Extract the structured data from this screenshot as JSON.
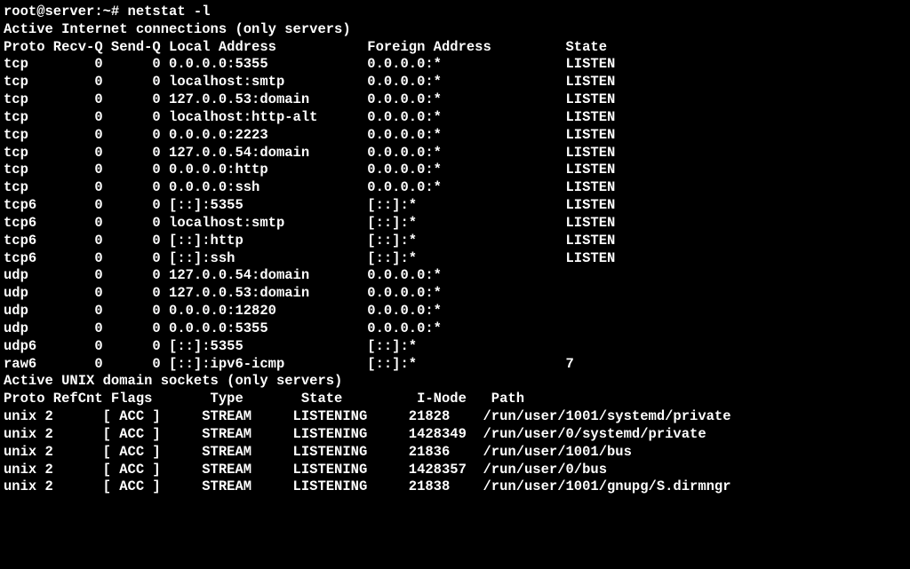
{
  "prompt_line": "root@server:~# netstat -l",
  "inet_header": "Active Internet connections (only servers)",
  "inet_cols": "Proto Recv-Q Send-Q Local Address           Foreign Address         State",
  "inet_rows": [
    {
      "proto": "tcp",
      "recvq": 0,
      "sendq": 0,
      "local": "0.0.0.0:5355",
      "foreign": "0.0.0.0:*",
      "state": "LISTEN"
    },
    {
      "proto": "tcp",
      "recvq": 0,
      "sendq": 0,
      "local": "localhost:smtp",
      "foreign": "0.0.0.0:*",
      "state": "LISTEN"
    },
    {
      "proto": "tcp",
      "recvq": 0,
      "sendq": 0,
      "local": "127.0.0.53:domain",
      "foreign": "0.0.0.0:*",
      "state": "LISTEN"
    },
    {
      "proto": "tcp",
      "recvq": 0,
      "sendq": 0,
      "local": "localhost:http-alt",
      "foreign": "0.0.0.0:*",
      "state": "LISTEN"
    },
    {
      "proto": "tcp",
      "recvq": 0,
      "sendq": 0,
      "local": "0.0.0.0:2223",
      "foreign": "0.0.0.0:*",
      "state": "LISTEN"
    },
    {
      "proto": "tcp",
      "recvq": 0,
      "sendq": 0,
      "local": "127.0.0.54:domain",
      "foreign": "0.0.0.0:*",
      "state": "LISTEN"
    },
    {
      "proto": "tcp",
      "recvq": 0,
      "sendq": 0,
      "local": "0.0.0.0:http",
      "foreign": "0.0.0.0:*",
      "state": "LISTEN"
    },
    {
      "proto": "tcp",
      "recvq": 0,
      "sendq": 0,
      "local": "0.0.0.0:ssh",
      "foreign": "0.0.0.0:*",
      "state": "LISTEN"
    },
    {
      "proto": "tcp6",
      "recvq": 0,
      "sendq": 0,
      "local": "[::]:5355",
      "foreign": "[::]:*",
      "state": "LISTEN"
    },
    {
      "proto": "tcp6",
      "recvq": 0,
      "sendq": 0,
      "local": "localhost:smtp",
      "foreign": "[::]:*",
      "state": "LISTEN"
    },
    {
      "proto": "tcp6",
      "recvq": 0,
      "sendq": 0,
      "local": "[::]:http",
      "foreign": "[::]:*",
      "state": "LISTEN"
    },
    {
      "proto": "tcp6",
      "recvq": 0,
      "sendq": 0,
      "local": "[::]:ssh",
      "foreign": "[::]:*",
      "state": "LISTEN"
    },
    {
      "proto": "udp",
      "recvq": 0,
      "sendq": 0,
      "local": "127.0.0.54:domain",
      "foreign": "0.0.0.0:*",
      "state": ""
    },
    {
      "proto": "udp",
      "recvq": 0,
      "sendq": 0,
      "local": "127.0.0.53:domain",
      "foreign": "0.0.0.0:*",
      "state": ""
    },
    {
      "proto": "udp",
      "recvq": 0,
      "sendq": 0,
      "local": "0.0.0.0:12820",
      "foreign": "0.0.0.0:*",
      "state": ""
    },
    {
      "proto": "udp",
      "recvq": 0,
      "sendq": 0,
      "local": "0.0.0.0:5355",
      "foreign": "0.0.0.0:*",
      "state": ""
    },
    {
      "proto": "udp6",
      "recvq": 0,
      "sendq": 0,
      "local": "[::]:5355",
      "foreign": "[::]:*",
      "state": ""
    },
    {
      "proto": "raw6",
      "recvq": 0,
      "sendq": 0,
      "local": "[::]:ipv6-icmp",
      "foreign": "[::]:*",
      "state": "7"
    }
  ],
  "unix_header": "Active UNIX domain sockets (only servers)",
  "unix_cols": "Proto RefCnt Flags       Type       State         I-Node   Path",
  "unix_rows": [
    {
      "proto": "unix",
      "refcnt": 2,
      "flags": "[ ACC ]",
      "type": "STREAM",
      "state": "LISTENING",
      "inode": 21828,
      "path": "/run/user/1001/systemd/private"
    },
    {
      "proto": "unix",
      "refcnt": 2,
      "flags": "[ ACC ]",
      "type": "STREAM",
      "state": "LISTENING",
      "inode": 1428349,
      "path": "/run/user/0/systemd/private"
    },
    {
      "proto": "unix",
      "refcnt": 2,
      "flags": "[ ACC ]",
      "type": "STREAM",
      "state": "LISTENING",
      "inode": 21836,
      "path": "/run/user/1001/bus"
    },
    {
      "proto": "unix",
      "refcnt": 2,
      "flags": "[ ACC ]",
      "type": "STREAM",
      "state": "LISTENING",
      "inode": 1428357,
      "path": "/run/user/0/bus"
    },
    {
      "proto": "unix",
      "refcnt": 2,
      "flags": "[ ACC ]",
      "type": "STREAM",
      "state": "LISTENING",
      "inode": 21838,
      "path": "/run/user/1001/gnupg/S.dirmngr"
    }
  ]
}
